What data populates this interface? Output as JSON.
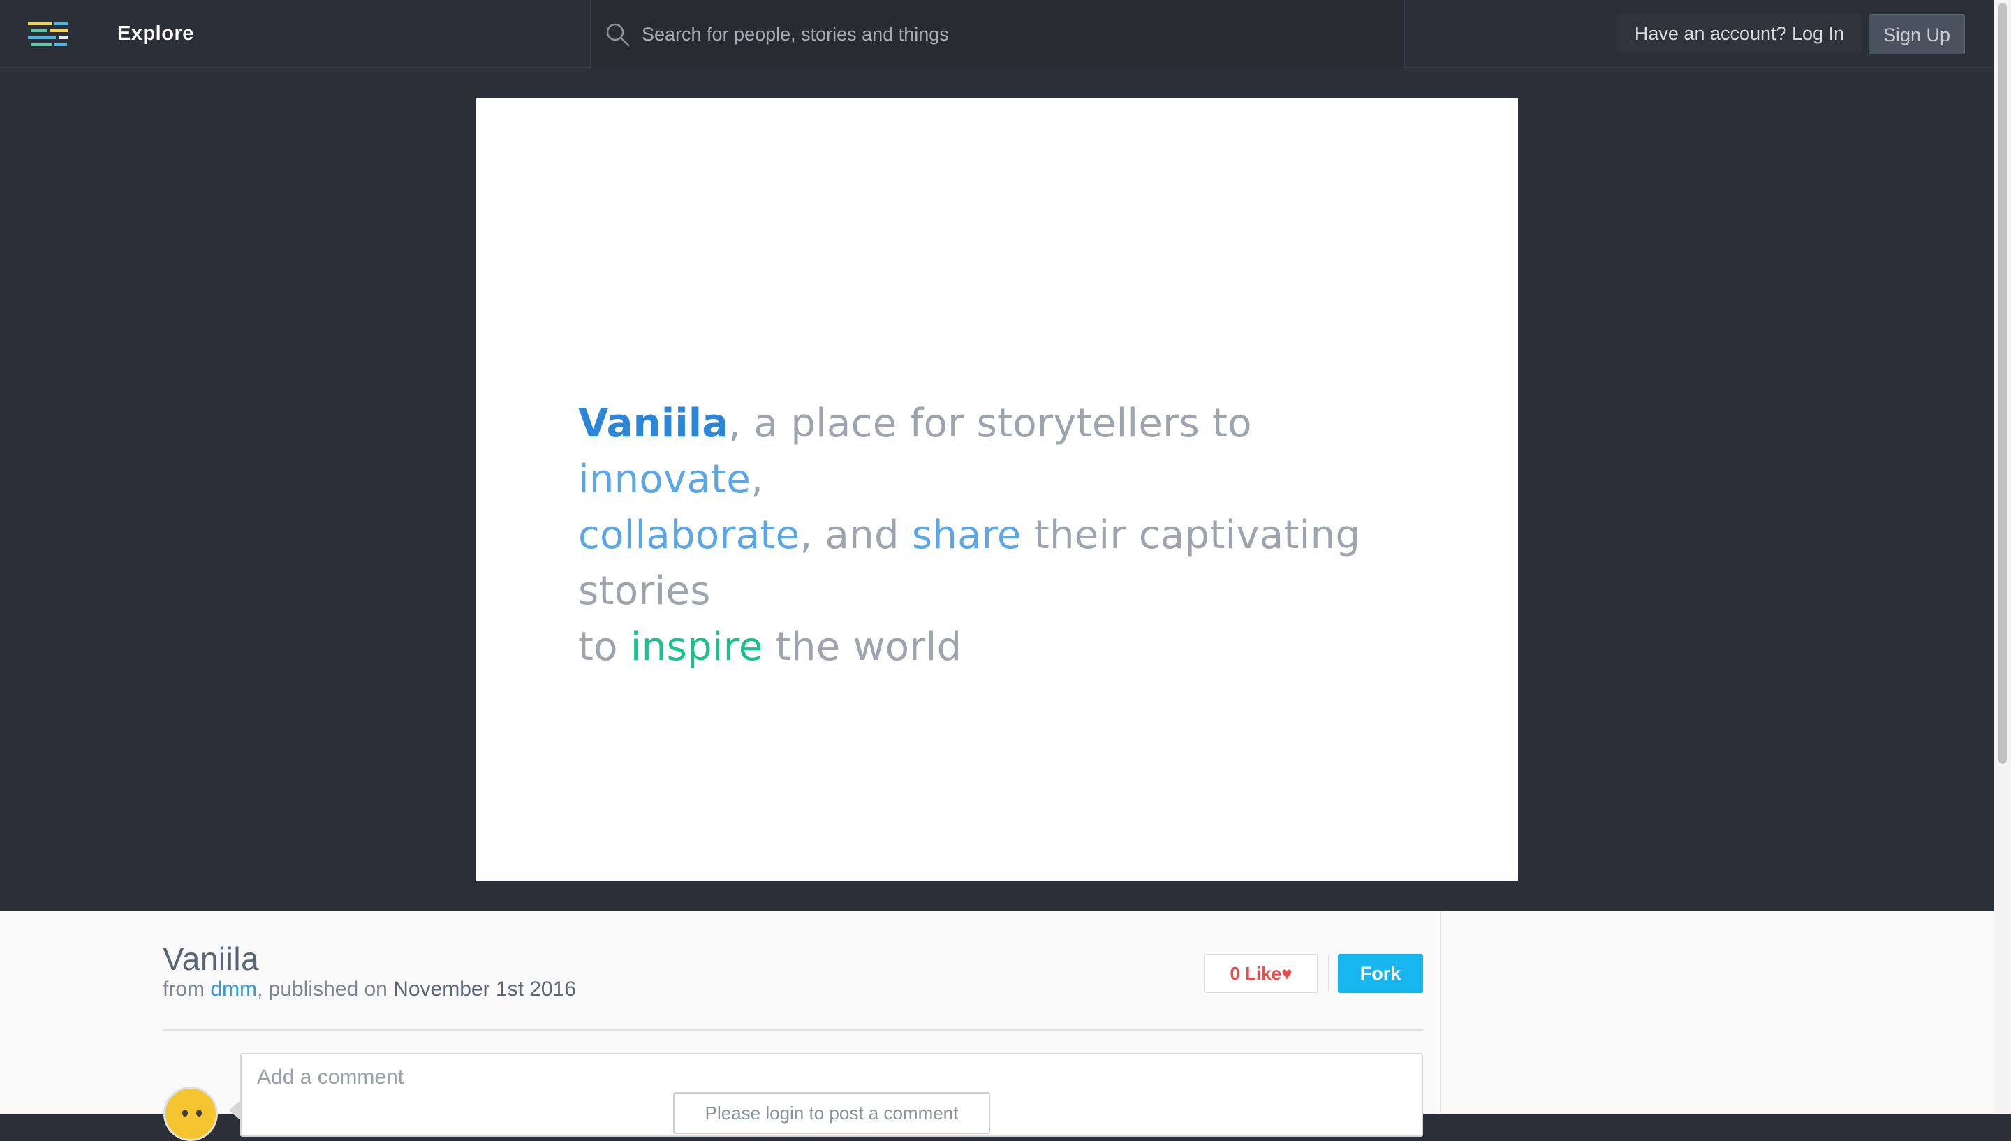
{
  "nav": {
    "explore_label": "Explore",
    "search_placeholder": "Search for people, stories and things",
    "login_label": "Have an account? Log In",
    "signup_label": "Sign Up",
    "logo_icon": "stacked-lines-logo-icon",
    "search_icon": "search-icon"
  },
  "card": {
    "brand": "Vaniila",
    "t1": ", a place for storytellers to ",
    "innovate": "innovate",
    "t2": ",",
    "collaborate": "collaborate",
    "t3": ", and ",
    "share": "share",
    "t4": " their captivating stories",
    "t5": "to ",
    "inspire": "inspire",
    "t6": " the world"
  },
  "story": {
    "title": "Vaniila",
    "from": "from ",
    "author": "dmm",
    "published": ", published on ",
    "date": "November 1st 2016",
    "like_label": "0 Like",
    "like_icon": "heart-icon",
    "fork_label": "Fork"
  },
  "comments": {
    "placeholder": "Add a comment",
    "login_prompt": "Please login to post a comment"
  },
  "colors": {
    "nav_bg": "#2b3038",
    "brand_blue": "#2b86d9",
    "highlight_blue": "#5aa6e8",
    "highlight_green": "#1dbf8f",
    "fork_blue": "#17b6ee",
    "like_red": "#ea4b4b"
  }
}
